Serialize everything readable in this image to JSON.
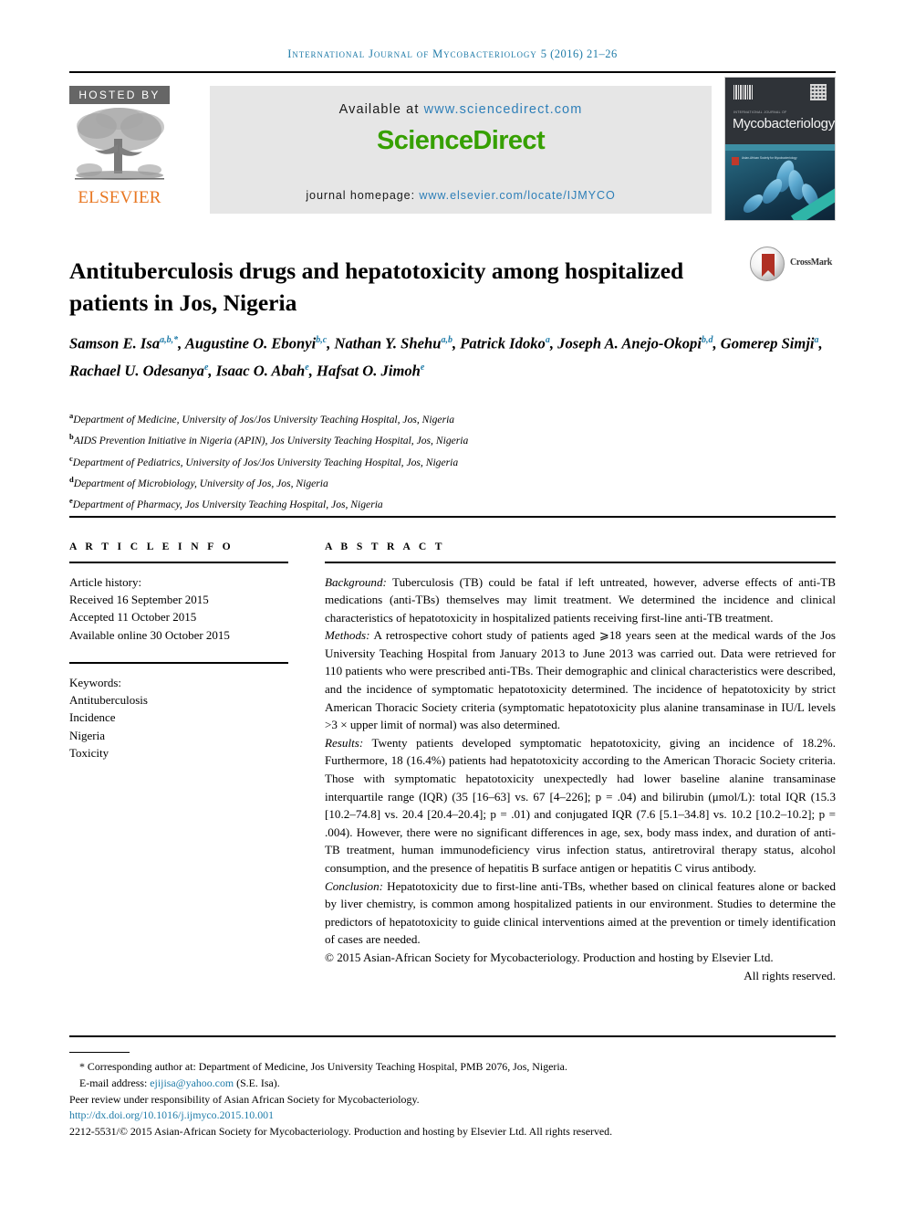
{
  "running_head": {
    "journal": "International Journal of Mycobacteriology",
    "volume_issue": "5 (2016) 21–26"
  },
  "masthead": {
    "hosted_by": "HOSTED BY",
    "publisher": "ELSEVIER",
    "available_prefix": "Available at ",
    "available_url": "www.sciencedirect.com",
    "sciencedirect_logo": "ScienceDirect",
    "homepage_prefix": "journal homepage: ",
    "homepage_url": "www.elsevier.com/locate/IJMYCO",
    "cover": {
      "sub_title": "INTERNATIONAL JOURNAL OF",
      "title": "Mycobacteriology",
      "mini_text": "Asian-African Society for Mycobacteriology"
    }
  },
  "article": {
    "title": "Antituberculosis drugs and hepatotoxicity among hospitalized patients in Jos, Nigeria",
    "crossmark_label": "CrossMark",
    "authors_line1_a": "Samson E. Isa",
    "authors_line1_a_sup": "a,b,*",
    "authors_line1_b": ", Augustine O. Ebonyi",
    "authors_line1_b_sup": "b,c",
    "authors_line1_c": ", Nathan Y. Shehu",
    "authors_line1_c_sup": "a,b",
    "authors_line1_d": ", Patrick Idoko",
    "authors_line1_d_sup": "a",
    "authors_line2_a": ", Joseph A. Anejo-Okopi",
    "authors_line2_a_sup": "b,d",
    "authors_line2_b": ", Gomerep Simji",
    "authors_line2_b_sup": "a",
    "authors_line2_c": ", Rachael U. Odesanya",
    "authors_line2_c_sup": "e",
    "authors_line2_d": ", Isaac O. Abah",
    "authors_line2_d_sup": "e",
    "authors_line3_a": ", Hafsat O. Jimoh",
    "authors_line3_a_sup": "e",
    "affiliations": [
      {
        "mark": "a",
        "text": "Department of Medicine, University of Jos/Jos University Teaching Hospital, Jos, Nigeria"
      },
      {
        "mark": "b",
        "text": "AIDS Prevention Initiative in Nigeria (APIN), Jos University Teaching Hospital, Jos, Nigeria"
      },
      {
        "mark": "c",
        "text": "Department of Pediatrics, University of Jos/Jos University Teaching Hospital, Jos, Nigeria"
      },
      {
        "mark": "d",
        "text": "Department of Microbiology, University of Jos, Jos, Nigeria"
      },
      {
        "mark": "e",
        "text": "Department of Pharmacy, Jos University Teaching Hospital, Jos, Nigeria"
      }
    ]
  },
  "article_info": {
    "heading": "A R T I C L E  I N F O",
    "history_label": "Article history:",
    "received": "Received 16 September 2015",
    "accepted": "Accepted 11 October 2015",
    "available_online": "Available online 30 October 2015",
    "keywords_label": "Keywords:",
    "keywords": [
      "Antituberculosis",
      "Incidence",
      "Nigeria",
      "Toxicity"
    ]
  },
  "abstract": {
    "heading": "A B S T R A C T",
    "sections": [
      {
        "label": "Background:",
        "text": " Tuberculosis (TB) could be fatal if left untreated, however, adverse effects of anti-TB medications (anti-TBs) themselves may limit treatment. We determined the incidence and clinical characteristics of hepatotoxicity in hospitalized patients receiving first-line anti-TB treatment."
      },
      {
        "label": "Methods:",
        "text": "  A retrospective cohort study of patients aged ⩾18 years seen at the medical wards of the Jos University Teaching Hospital from January 2013 to June 2013 was carried out. Data were retrieved for 110 patients who were prescribed anti-TBs. Their demographic and clinical characteristics were described, and the incidence of symptomatic hepatotoxicity determined. The incidence of hepatotoxicity by strict American Thoracic Society criteria (symptomatic hepatotoxicity plus alanine transaminase in IU/L levels >3 × upper limit of normal) was also determined."
      },
      {
        "label": "Results:",
        "text": " Twenty patients developed symptomatic hepatotoxicity, giving an incidence of 18.2%. Furthermore, 18 (16.4%) patients had hepatotoxicity according to the American Thoracic Society criteria. Those with symptomatic hepatotoxicity unexpectedly had lower baseline alanine transaminase interquartile range (IQR) (35 [16–63] vs. 67 [4–226]; p = .04) and bilirubin (μmol/L): total IQR (15.3 [10.2–74.8] vs. 20.4 [20.4–20.4]; p = .01) and conjugated IQR (7.6 [5.1–34.8] vs. 10.2 [10.2–10.2]; p = .004). However, there were no significant differences in age, sex, body mass index, and duration of anti-TB treatment, human immunodeficiency virus infection status, antiretroviral therapy status, alcohol consumption, and the presence of hepatitis B surface antigen or hepatitis C virus antibody."
      },
      {
        "label": "Conclusion:",
        "text": " Hepatotoxicity due to first-line anti-TBs, whether based on clinical features alone or backed by liver chemistry, is common among hospitalized patients in our environment. Studies to determine the predictors of hepatotoxicity to guide clinical interventions aimed at the prevention or timely identification of cases are needed."
      }
    ],
    "copyright_line": "© 2015 Asian-African Society for Mycobacteriology. Production and hosting by Elsevier Ltd.",
    "rights_line": "All rights reserved."
  },
  "footnotes": {
    "corresponding": "* Corresponding author at: Department of Medicine, Jos University Teaching Hospital, PMB 2076, Jos, Nigeria.",
    "email_label": "E-mail address: ",
    "email": "ejijisa@yahoo.com",
    "email_suffix": " (S.E. Isa).",
    "peer_review": "Peer review under responsibility of Asian African Society for Mycobacteriology.",
    "doi": "http://dx.doi.org/10.1016/j.ijmyco.2015.10.001",
    "issn_line": "2212-5531/© 2015 Asian-African Society for Mycobacteriology. Production and hosting by Elsevier Ltd. All rights reserved."
  },
  "colors": {
    "link_blue": "#1f7ba8",
    "sciencedirect_green": "#36a000",
    "elsevier_orange": "#E87722",
    "crossmark_red": "#b03024"
  }
}
